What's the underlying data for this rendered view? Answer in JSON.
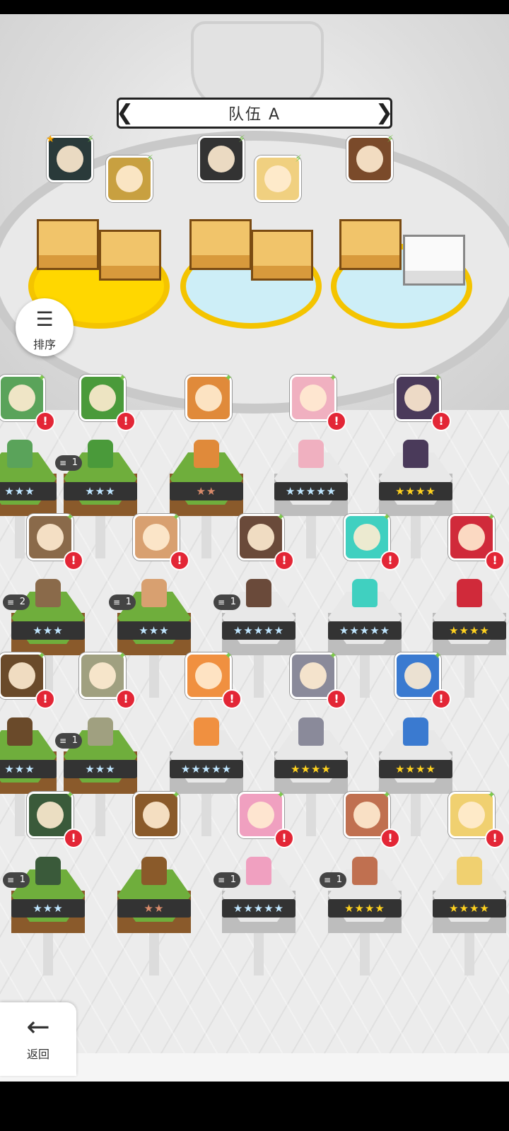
{
  "team": {
    "title": "队伍 A",
    "prev_arrow": "❮",
    "next_arrow": "❯"
  },
  "sort_button": {
    "label": "排序",
    "icon": "sort-icon"
  },
  "back_button": {
    "label": "返回",
    "icon": "arrow-left-icon"
  },
  "colors": {
    "alert": "#e32636",
    "gold_pad": "#ffd700",
    "ice_pad": "#cdeef7",
    "grass": "#6fae3c",
    "stone": "#e8e8e8",
    "star_gold": "#ffd21f",
    "star_blue": "#bfe6ff",
    "star_bronze": "#d88a6a"
  },
  "roster": [
    {
      "stars": "★★★",
      "star_color": "blue",
      "base": "green",
      "dup": "",
      "alert": "!",
      "avatar": "#5aa35a"
    },
    {
      "stars": "★★★",
      "star_color": "blue",
      "base": "green",
      "dup": "1",
      "alert": "!",
      "avatar": "#4a9a3a"
    },
    {
      "stars": "★★",
      "star_color": "bronze",
      "base": "green",
      "dup": "",
      "alert": "",
      "avatar": "#e08a3a"
    },
    {
      "stars": "★★★★★",
      "star_color": "blue",
      "base": "stone",
      "dup": "",
      "alert": "!",
      "avatar": "#f0b0c0"
    },
    {
      "stars": "★★★★",
      "star_color": "gold",
      "base": "stone",
      "dup": "",
      "alert": "!",
      "avatar": "#4a3a5a"
    },
    {
      "stars": "★★★",
      "star_color": "blue",
      "base": "green",
      "dup": "2",
      "alert": "!",
      "avatar": "#8a6a4a"
    },
    {
      "stars": "★★★",
      "star_color": "blue",
      "base": "green",
      "dup": "1",
      "alert": "!",
      "avatar": "#d8a070"
    },
    {
      "stars": "★★★★★",
      "star_color": "blue",
      "base": "stone",
      "dup": "1",
      "alert": "!",
      "avatar": "#6a4a3a"
    },
    {
      "stars": "★★★★★",
      "star_color": "blue",
      "base": "stone",
      "dup": "",
      "alert": "!",
      "avatar": "#40d0c0"
    },
    {
      "stars": "★★★★",
      "star_color": "gold",
      "base": "stone",
      "dup": "",
      "alert": "!",
      "avatar": "#d02a3a"
    },
    {
      "stars": "★★★",
      "star_color": "blue",
      "base": "green",
      "dup": "",
      "alert": "!",
      "avatar": "#6a4a2a"
    },
    {
      "stars": "★★★",
      "star_color": "blue",
      "base": "green",
      "dup": "1",
      "alert": "!",
      "avatar": "#a0a080"
    },
    {
      "stars": "★★★★★",
      "star_color": "blue",
      "base": "stone",
      "dup": "",
      "alert": "!",
      "avatar": "#f09040"
    },
    {
      "stars": "★★★★",
      "star_color": "gold",
      "base": "stone",
      "dup": "",
      "alert": "!",
      "avatar": "#8a8a9a"
    },
    {
      "stars": "★★★★",
      "star_color": "gold",
      "base": "stone",
      "dup": "",
      "alert": "!",
      "avatar": "#3a7ad0"
    },
    {
      "stars": "★★★",
      "star_color": "blue",
      "base": "green",
      "dup": "1",
      "alert": "!",
      "avatar": "#3a5a3a"
    },
    {
      "stars": "★★",
      "star_color": "bronze",
      "base": "green",
      "dup": "",
      "alert": "",
      "avatar": "#8a5a2a"
    },
    {
      "stars": "★★★★★",
      "star_color": "blue",
      "base": "stone",
      "dup": "1",
      "alert": "!",
      "avatar": "#f0a0c0"
    },
    {
      "stars": "★★★★",
      "star_color": "gold",
      "base": "stone",
      "dup": "1",
      "alert": "!",
      "avatar": "#c07050"
    },
    {
      "stars": "★★★★",
      "star_color": "gold",
      "base": "stone",
      "dup": "",
      "alert": "!",
      "avatar": "#f0d070"
    }
  ],
  "team_slots": [
    {
      "avatar": "#2a3a3a",
      "marker": "★",
      "tag": "⚡"
    },
    {
      "avatar": "#c8a040",
      "marker": "",
      "tag": "⚡"
    },
    {
      "avatar": "#333",
      "marker": "",
      "tag": "⚡"
    },
    {
      "avatar": "#f0d080",
      "marker": "",
      "tag": "⚡"
    },
    {
      "avatar": "#7a4a2a",
      "marker": "",
      "tag": "⚡"
    }
  ]
}
